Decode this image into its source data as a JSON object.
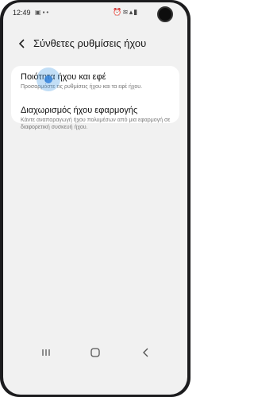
{
  "status": {
    "time": "12:49",
    "left_icons": [
      "gallery-icon",
      "image-icon",
      "notification-dot-icon"
    ],
    "right_icons": [
      "alarm-icon",
      "wifi-icon",
      "signal-icon",
      "battery-icon"
    ]
  },
  "header": {
    "back_icon": "chevron-left-icon",
    "title": "Σύνθετες ρυθμίσεις ήχου"
  },
  "settings": {
    "items": [
      {
        "title": "Ποιότητα ήχου και εφέ",
        "subtitle": "Προσαρμόστε τις ρυθμίσεις ήχου και τα εφέ ήχου."
      },
      {
        "title": "Διαχωρισμός ήχου εφαρμογής",
        "subtitle": "Κάντε αναπαραγωγή ήχου πολυμέσων από μια εφαρμογή σε διαφορετική συσκευή ήχου."
      }
    ]
  },
  "navbar": {
    "recents_icon": "recents-icon",
    "home_icon": "home-icon",
    "back_icon": "back-icon"
  },
  "colors": {
    "background": "#f1f1f1",
    "card": "#ffffff",
    "touch_indicator": "#3282dc"
  }
}
